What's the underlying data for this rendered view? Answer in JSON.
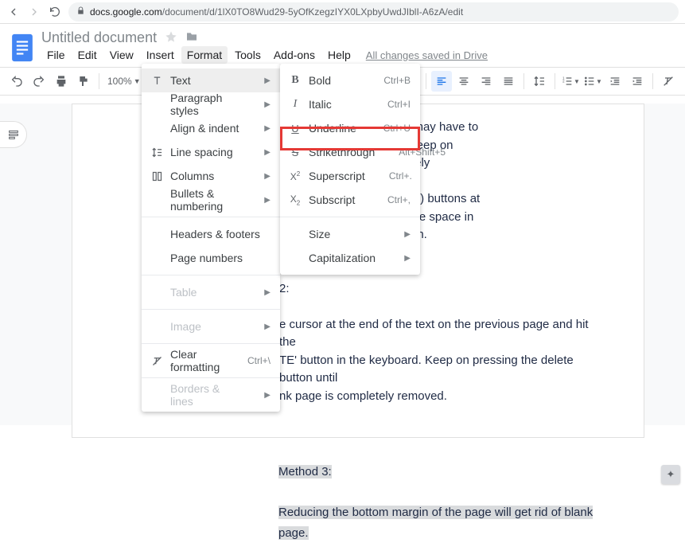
{
  "browser": {
    "url_host": "docs.google.com",
    "url_path": "/document/d/1lX0TO8Wud29-5yOfKzegzIYX0LXpbyUwdJIblI-A6zA/edit"
  },
  "doc": {
    "title": "Untitled document",
    "menus": [
      "File",
      "Edit",
      "View",
      "Insert",
      "Format",
      "Tools",
      "Add-ons",
      "Help"
    ],
    "save_note": "All changes saved in Drive"
  },
  "toolbar": {
    "zoom": "100%"
  },
  "format_menu": {
    "items": [
      {
        "label": "Text",
        "arrow": true,
        "icon": "text",
        "hl": true
      },
      {
        "label": "Paragraph styles",
        "arrow": true
      },
      {
        "label": "Align & indent",
        "arrow": true
      },
      {
        "label": "Line spacing",
        "arrow": true,
        "icon": "linespacing"
      },
      {
        "label": "Columns",
        "arrow": true,
        "icon": "columns"
      },
      {
        "label": "Bullets & numbering",
        "arrow": true
      },
      {
        "sep": true
      },
      {
        "label": "Headers & footers"
      },
      {
        "label": "Page numbers"
      },
      {
        "sep": true
      },
      {
        "label": "Table",
        "arrow": true,
        "disabled": true
      },
      {
        "sep": true
      },
      {
        "label": "Image",
        "arrow": true,
        "disabled": true
      },
      {
        "sep": true
      },
      {
        "label": "Clear formatting",
        "shortcut": "Ctrl+\\",
        "icon": "clear"
      },
      {
        "sep": true
      },
      {
        "label": "Borders & lines",
        "arrow": true,
        "disabled": true
      }
    ]
  },
  "text_submenu": {
    "items": [
      {
        "label": "Bold",
        "shortcut": "Ctrl+B",
        "icon": "B"
      },
      {
        "label": "Italic",
        "shortcut": "Ctrl+I",
        "icon": "I"
      },
      {
        "label": "Underline",
        "shortcut": "Ctrl+U",
        "icon": "U"
      },
      {
        "label": "Strikethrough",
        "shortcut": "Alt+Shift+5",
        "icon": "S"
      },
      {
        "label": "Superscript",
        "shortcut": "Ctrl+.",
        "icon": "X2"
      },
      {
        "label": "Subscript",
        "shortcut": "Ctrl+,",
        "icon": "Xs"
      },
      {
        "sep": true
      },
      {
        "label": "Size",
        "arrow": true
      },
      {
        "label": "Capitalization",
        "arrow": true
      }
    ]
  },
  "doc_body": {
    "frag1": "the blank page, then you may have to",
    "frag2": "e on the blank page and keep on",
    "frag3": "the blank page is completely",
    "frag4": "cut by pressing (Ctrl + End) buttons at",
    "frag5": "o the last character or white space in",
    "frag6": "sing the 'Backspace' button.",
    "method2": "2:",
    "m2_l1": "e cursor at the end of the text on the previous page and hit the",
    "m2_l2": "TE' button in the keyboard. Keep on pressing the delete button until",
    "m2_l3": "nk page is completely removed.",
    "method3": "Method 3:",
    "m3_text": "Reducing the bottom margin of the page will get rid of blank page."
  }
}
